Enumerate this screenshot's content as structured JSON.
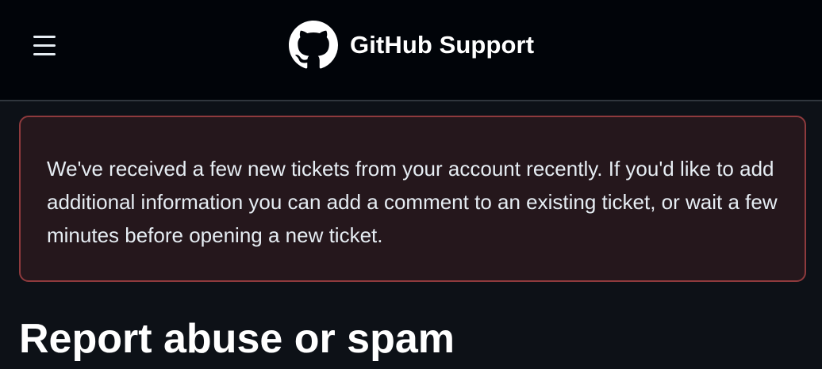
{
  "header": {
    "menu_icon": "hamburger-menu-icon",
    "logo_icon": "github-octocat-icon",
    "title": "GitHub Support"
  },
  "flash": {
    "message": "We've received a few new tickets from your account recently. If you'd like to add additional information you can add a comment to an existing ticket, or wait a few minutes before opening a new ticket."
  },
  "main": {
    "title": "Report abuse or spam"
  },
  "colors": {
    "page_background": "#0d1117",
    "header_background": "#010409",
    "header_border": "#30363d",
    "flash_background": "#25171c",
    "flash_border": "#8e3a3d",
    "text": "#e6edf3"
  }
}
